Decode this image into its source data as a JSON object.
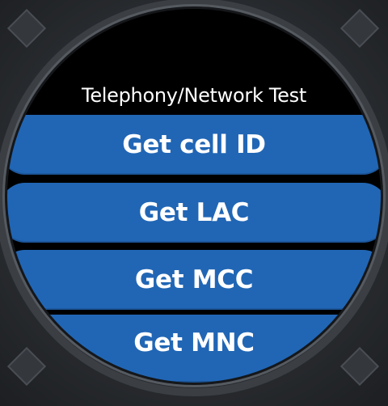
{
  "screen": {
    "title": "Telephony/Network Test",
    "menu_items": [
      {
        "label": "Get cell ID"
      },
      {
        "label": "Get LAC"
      },
      {
        "label": "Get MCC"
      },
      {
        "label": "Get MNC"
      }
    ]
  },
  "colors": {
    "button_background": "#2166b5",
    "screen_background": "#000000",
    "text": "#ffffff",
    "bezel": "#2a2d31"
  }
}
